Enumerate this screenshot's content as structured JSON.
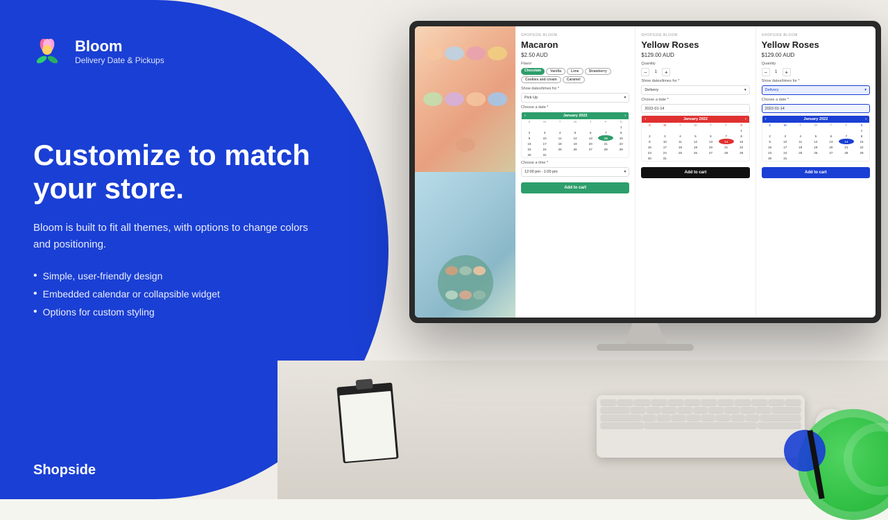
{
  "app": {
    "title": "Bloom",
    "subtitle": "Delivery Date & Pickups"
  },
  "hero": {
    "headline_line1": "Customize to match",
    "headline_line2": "your store.",
    "description": "Bloom is built to fit all themes, with options to change colors and positioning.",
    "bullets": [
      "Simple, user-friendly design",
      "Embedded calendar or collapsible widget",
      "Options for custom styling"
    ]
  },
  "branding": {
    "shopside": "Shopside"
  },
  "screen": {
    "panel1": {
      "brand": "SHOPSIDE BLOOM",
      "title": "Macaron",
      "price": "$2.50 AUD",
      "flavor_label": "Flavor",
      "tags": [
        "Chocolate",
        "Vanilla",
        "Lime",
        "Strawberry",
        "Cookies and cream",
        "Caramel"
      ],
      "show_dates_label": "Show dates/times for *",
      "dropdown_value": "Pick Up",
      "choose_date_label": "Choose a date *",
      "calendar_month": "January 2022",
      "add_to_cart": "Add to cart"
    },
    "panel2": {
      "brand": "SHOPSIDE BLOOM",
      "title": "Yellow Roses",
      "price": "$129.00 AUD",
      "qty_label": "Quantity",
      "qty": "1",
      "show_dates_label": "Show dates/times for *",
      "dropdown_value": "Delivery",
      "choose_date_label": "Choose a date *",
      "date_value": "2022-01-14",
      "calendar_month": "January 2022",
      "add_to_cart": "Add to cart"
    },
    "panel3": {
      "brand": "SHOPSIDE BLOOM",
      "title": "Yellow Roses",
      "price": "$129.00 AUD",
      "qty_label": "Quantity",
      "qty": "1",
      "show_dates_label": "Show dates/times for *",
      "dropdown_value": "Delivery",
      "choose_date_label": "Choose a date *",
      "date_value": "2022-01-14",
      "calendar_month": "January 2022",
      "add_to_cart": "Add to cart"
    }
  }
}
